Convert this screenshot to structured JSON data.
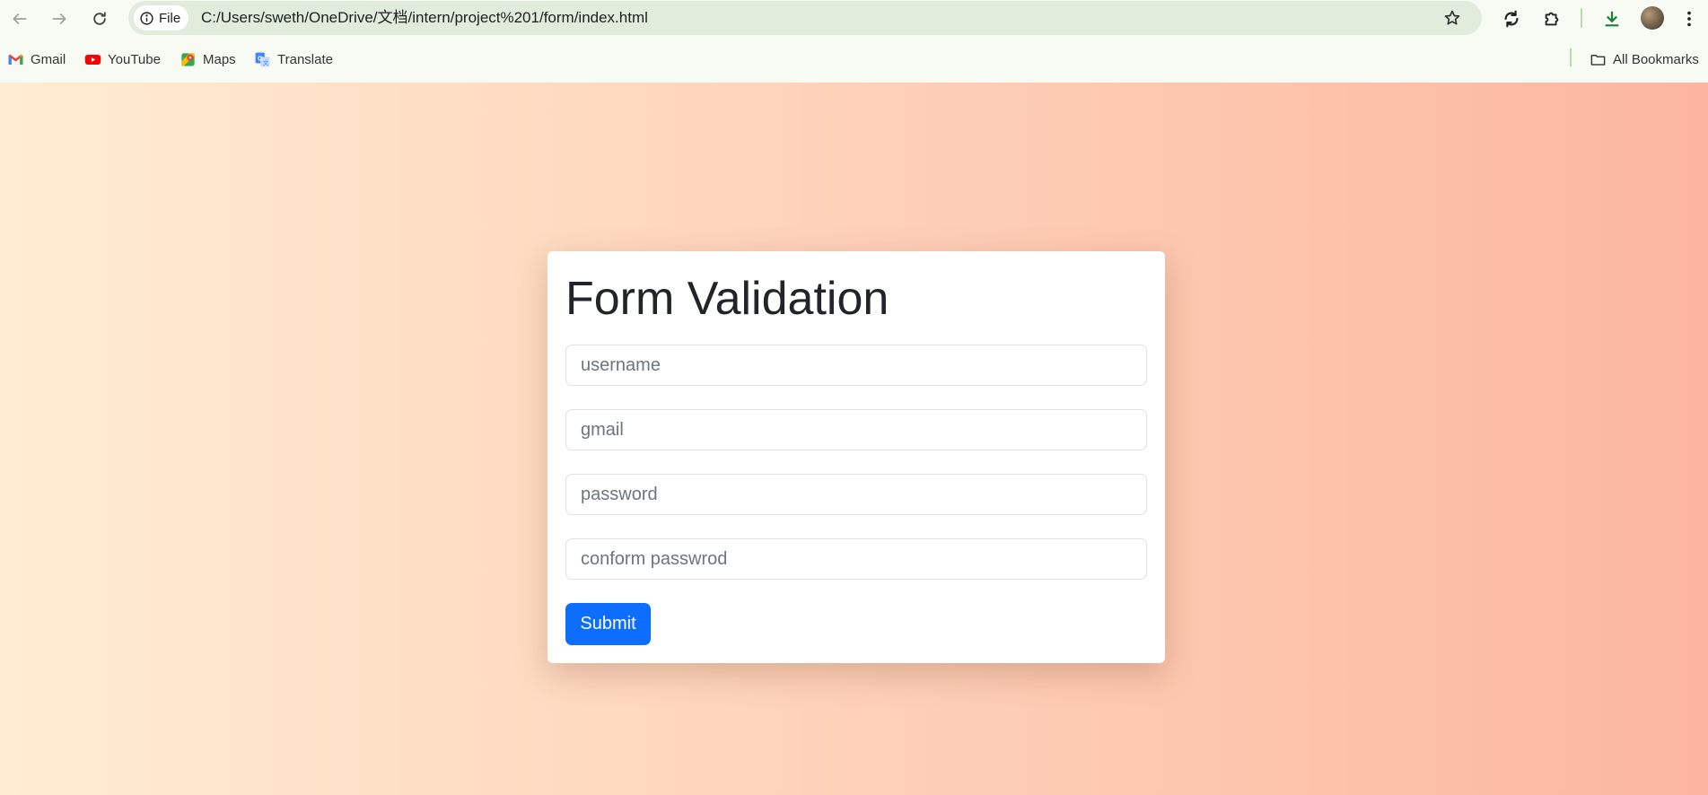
{
  "browser": {
    "file_chip_label": "File",
    "url": "C:/Users/sweth/OneDrive/文档/intern/project%201/form/index.html",
    "bookmarks": [
      {
        "label": "Gmail",
        "icon": "gmail-icon"
      },
      {
        "label": "YouTube",
        "icon": "youtube-icon"
      },
      {
        "label": "Maps",
        "icon": "maps-icon"
      },
      {
        "label": "Translate",
        "icon": "translate-icon"
      }
    ],
    "all_bookmarks_label": "All Bookmarks"
  },
  "page": {
    "background_gradient": [
      "#ffecd2",
      "#fcb69f"
    ],
    "form": {
      "title": "Form Validation",
      "fields": [
        {
          "name": "username",
          "placeholder": "username",
          "value": ""
        },
        {
          "name": "gmail",
          "placeholder": "gmail",
          "value": ""
        },
        {
          "name": "password",
          "placeholder": "password",
          "value": ""
        },
        {
          "name": "confirm-password",
          "placeholder": "conform passwrod",
          "value": ""
        }
      ],
      "submit_label": "Submit",
      "submit_color": "#0d6efd"
    }
  }
}
